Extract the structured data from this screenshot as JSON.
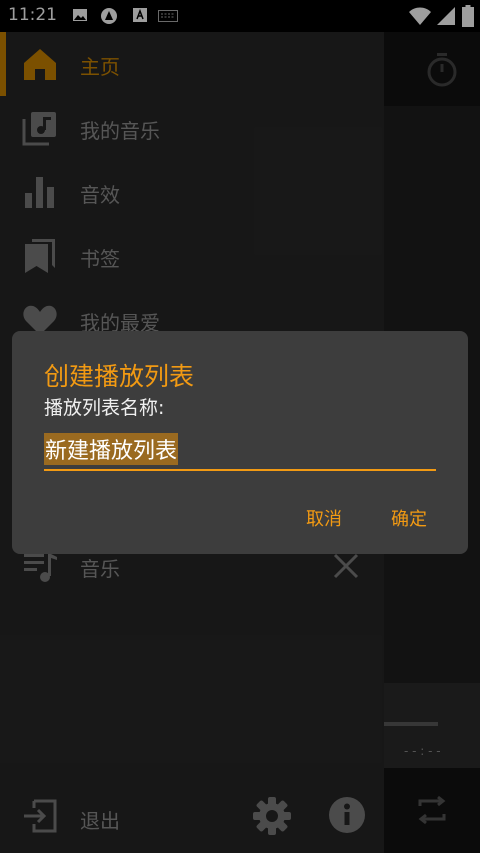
{
  "status_bar": {
    "time": "11:21"
  },
  "drawer": {
    "items": [
      {
        "label": "主页",
        "icon": "home-icon"
      },
      {
        "label": "我的音乐",
        "icon": "music-library-icon"
      },
      {
        "label": "音效",
        "icon": "equalizer-icon"
      },
      {
        "label": "书签",
        "icon": "bookmarks-icon"
      },
      {
        "label": "我的最爱",
        "icon": "heart-icon"
      }
    ],
    "playlist_item": {
      "label": "音乐",
      "icon": "playlist-icon"
    },
    "footer": {
      "exit_label": "退出"
    }
  },
  "dialog": {
    "title": "创建播放列表",
    "field_label": "播放列表名称:",
    "input_value": "新建播放列表",
    "cancel_label": "取消",
    "confirm_label": "确定"
  },
  "colors": {
    "accent": "#F29A13",
    "active": "#C78100",
    "drawer_bg": "#262626",
    "dialog_bg": "#3D3D3D"
  }
}
